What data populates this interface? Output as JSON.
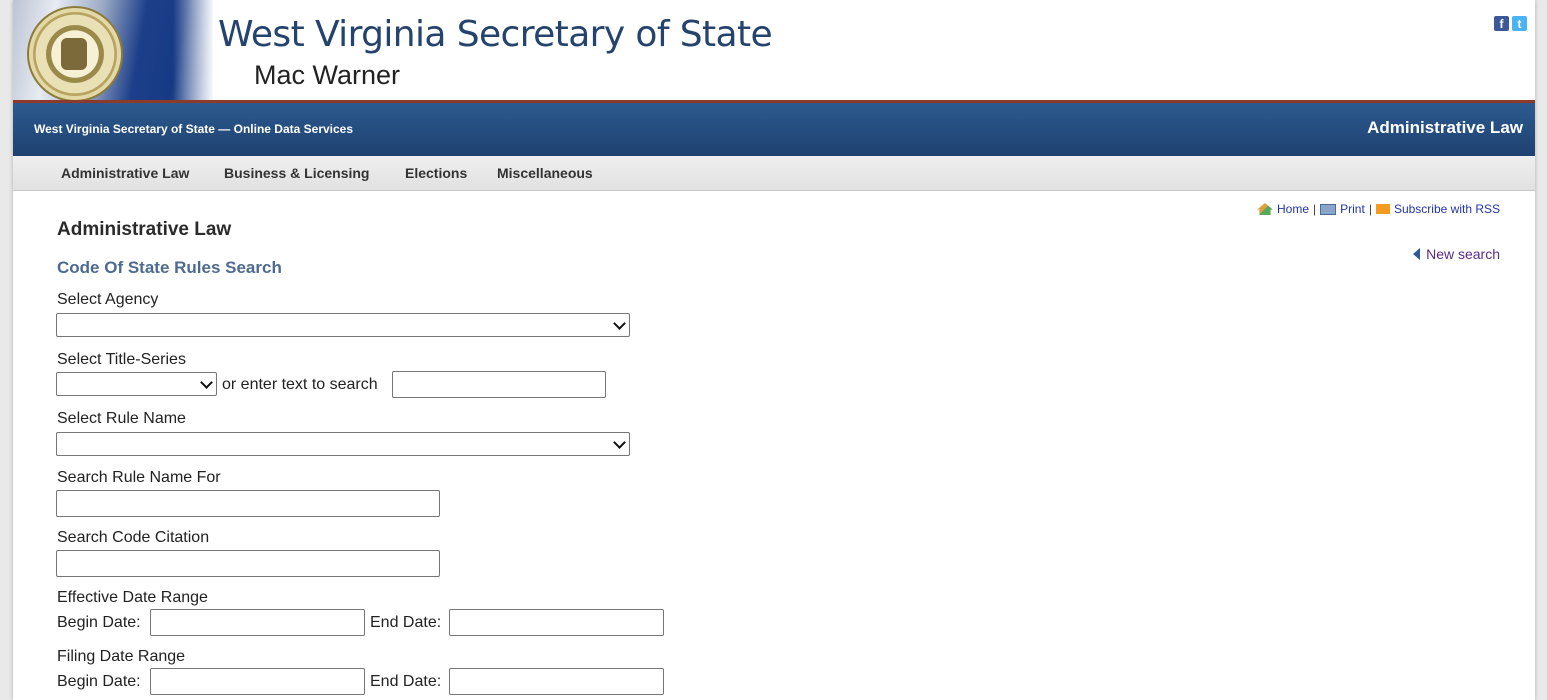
{
  "header": {
    "title": "West Virginia Secretary of State",
    "subtitle": "Mac Warner",
    "social": {
      "facebook": "f",
      "twitter": "t"
    }
  },
  "bluebar": {
    "left_text": "West Virginia Secretary of State — Online Data Services",
    "right_text": "Administrative Law"
  },
  "nav": {
    "items": [
      "Administrative Law",
      "Business & Licensing",
      "Elections",
      "Miscellaneous"
    ]
  },
  "utility": {
    "home": "Home",
    "print": "Print",
    "rss": "Subscribe with RSS",
    "sep": "|"
  },
  "new_search": "New search",
  "main": {
    "heading": "Administrative Law",
    "subheading": "Code Of State Rules Search",
    "select_agency_label": "Select Agency",
    "select_title_series_label": "Select Title-Series",
    "or_text": "or enter text to search",
    "select_rule_name_label": "Select Rule Name",
    "search_rule_name_label": "Search Rule Name For",
    "search_code_citation_label": "Search Code Citation",
    "effective_date_label": "Effective Date Range",
    "filing_date_label": "Filing Date Range",
    "begin_date": "Begin Date:",
    "end_date": "End Date:"
  },
  "colors": {
    "blue_bar": "#1e4170",
    "title_blue": "#24436d",
    "link": "#2335a8"
  }
}
